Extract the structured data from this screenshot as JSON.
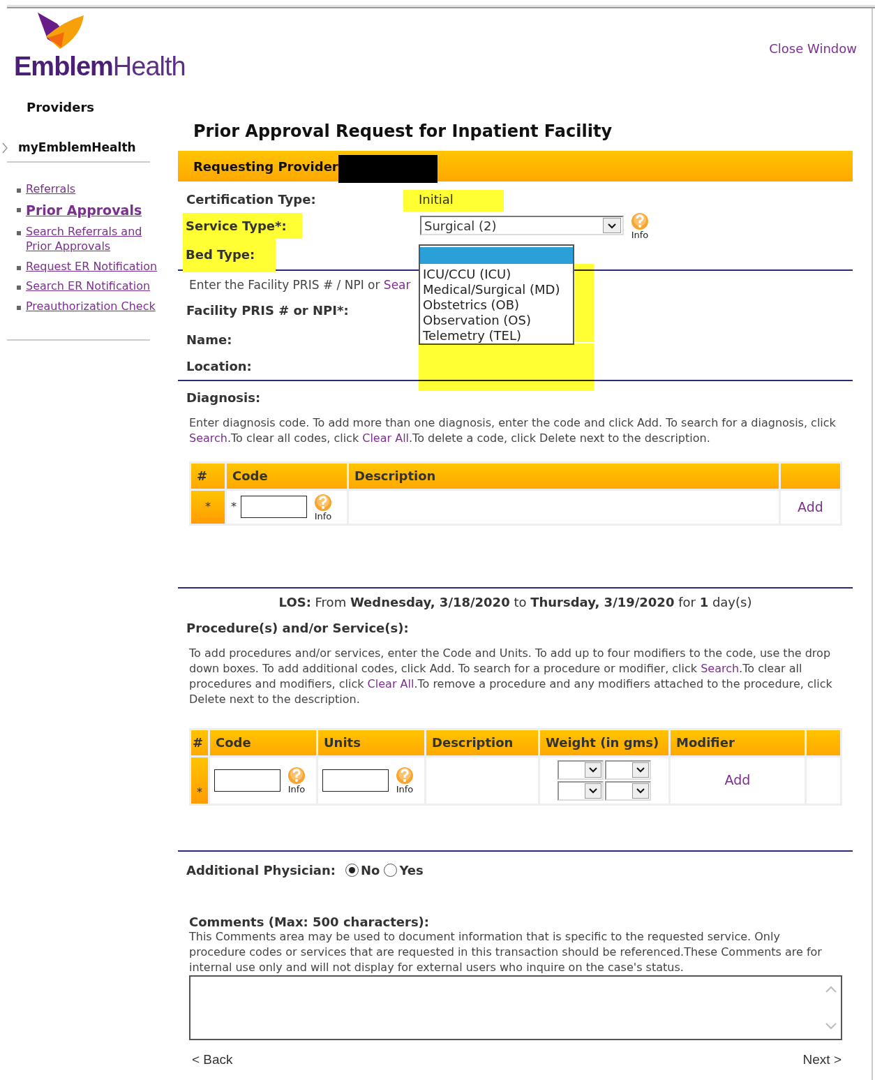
{
  "brand": {
    "bold": "Emblem",
    "light": "Health"
  },
  "close_link": "Close Window",
  "sidebar": {
    "heading": "Providers",
    "section": "myEmblemHealth",
    "items": [
      {
        "label": "Referrals",
        "selected": false
      },
      {
        "label": "Prior Approvals",
        "selected": true
      },
      {
        "label": "Search Referrals and Prior Approvals",
        "selected": false
      },
      {
        "label": "Request ER Notification",
        "selected": false
      },
      {
        "label": "Search ER Notification",
        "selected": false
      },
      {
        "label": "Preauthorization Check",
        "selected": false
      }
    ]
  },
  "title": "Prior Approval Request for Inpatient Facility",
  "provider_bar": {
    "label": "Requesting Provider"
  },
  "certification": {
    "label": "Certification Type:",
    "value": "Initial"
  },
  "service_type": {
    "label": "Service Type*:",
    "value": "Surgical (2)",
    "info": "Info"
  },
  "bed_type": {
    "label": "Bed Type:",
    "options": [
      "ICU/CCU (ICU)",
      "Medical/Surgical (MD)",
      "Obstetrics (OB)",
      "Observation (OS)",
      "Telemetry (TEL)"
    ]
  },
  "facility_hint": [
    {
      "text": "Enter the Facility PRIS # / NPI or "
    },
    {
      "link": "Sear"
    }
  ],
  "facility_fields": [
    "Facility PRIS # or NPI*:",
    "Name:",
    "Location:"
  ],
  "diagnosis": {
    "heading": "Diagnosis:",
    "instructions": [
      {
        "text": "Enter diagnosis code. To add more than one diagnosis, enter the code and click Add. To search for a diagnosis, click "
      },
      {
        "link": "Search"
      },
      {
        "text": ".To clear all codes, click "
      },
      {
        "link": "Clear All"
      },
      {
        "text": ".To delete a code, click Delete next to the description."
      }
    ],
    "columns": [
      "#",
      "Code",
      "Description"
    ],
    "row": {
      "marker": "*",
      "required": "*",
      "info": "Info",
      "add": "Add"
    }
  },
  "los": "**LOS:** From **Wednesday, 3/18/2020** to **Thursday, 3/19/2020** for **1** day(s)",
  "procedures": {
    "heading": "Procedure(s) and/or Service(s):",
    "instructions": [
      {
        "text": "To add procedures and/or services, enter the Code and Units. To add up to four modifiers to the code, use the drop down boxes. To add additional codes, click Add. To search for a procedure or modifier, click "
      },
      {
        "link": "Search"
      },
      {
        "text": ".To clear all procedures and modifiers, click "
      },
      {
        "link": "Clear All"
      },
      {
        "text": ".To remove a procedure and any modifiers attached to the procedure, click Delete next to the description."
      }
    ],
    "columns": [
      "#",
      "Code",
      "Units",
      "Description",
      "Weight (in gms)",
      "Modifier"
    ],
    "row": {
      "marker": "*",
      "code_info": "Info",
      "units_info": "Info",
      "add": "Add"
    }
  },
  "additional_physician": {
    "label": "Additional Physician:",
    "options": [
      {
        "label": "No",
        "selected": true
      },
      {
        "label": "Yes",
        "selected": false
      }
    ]
  },
  "comments": {
    "heading": "Comments (Max: 500 characters):",
    "text": "This Comments area may be used to document information that is specific to the requested service. Only procedure codes or services that are requested in this transaction should be referenced.These Comments are for internal use only and will not display for external users who inquire on the case's status."
  },
  "back": "< Back",
  "next": "Next >"
}
